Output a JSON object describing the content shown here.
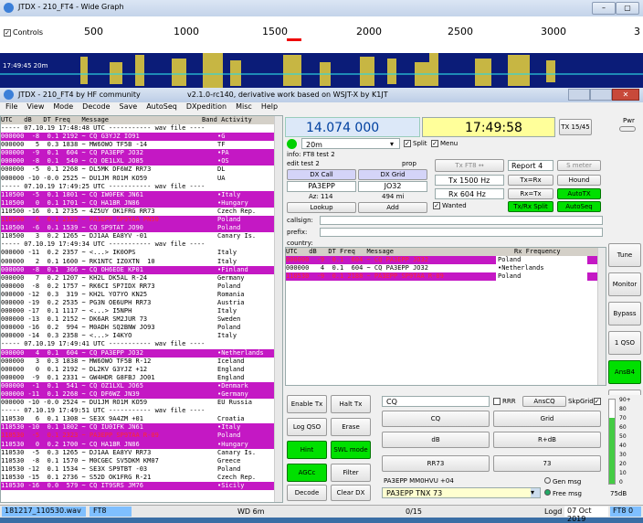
{
  "wide_graph": {
    "title": "JTDX - 210_FT4 - Wide Graph",
    "controls_label": "Controls",
    "scale_ticks": [
      "500",
      "1000",
      "1500",
      "2000",
      "2500",
      "3000",
      "3"
    ],
    "timestamp": "17:49:45  20m"
  },
  "main": {
    "title": "JTDX - 210_FT4  by HF community",
    "subtitle": "v2.1.0-rc140, derivative work based on WSJT-X by K1JT",
    "menu": [
      "File",
      "View",
      "Mode",
      "Decode",
      "Save",
      "AutoSeq",
      "DXpedition",
      "Misc",
      "Help"
    ]
  },
  "band_activity": {
    "header": "UTC   dB   DT Freq   Message",
    "header_right": "Band Activity",
    "rows": [
      {
        "text": "----- 07.10.19 17:48:48 UTC ----------- wav file ----",
        "cty": "",
        "style": "sep"
      },
      {
        "text": "000000  -8  0.1 2192 ~ CQ G3YJZ IO91",
        "cty": "•G",
        "style": "cq"
      },
      {
        "text": "000000   5  0.3 1838 ~ MW6OWO TF5B -14",
        "cty": "TF",
        "style": ""
      },
      {
        "text": "000000  -9  0.1  604 ~ CQ PA3EPP JO32",
        "cty": "•PA",
        "style": "cq"
      },
      {
        "text": "000000  -8  0.1  540 ~ CQ OE1LXL JO85",
        "cty": "•OS",
        "style": "cq"
      },
      {
        "text": "000000  -5  0.1 2268 ~ DL5MK DF6WZ RR73",
        "cty": "DL",
        "style": ""
      },
      {
        "text": "000000 -10 -0.0 2525 ~ DU1JM RO1M KO59",
        "cty": "UA",
        "style": ""
      },
      {
        "text": "----- 07.10.19 17:49:25 UTC ----------- wav file ----",
        "cty": "",
        "style": "sep"
      },
      {
        "text": "110500  -5  0.1 1801 ~ CQ IW0FEK JN61",
        "cty": "•Italy",
        "style": "cq"
      },
      {
        "text": "110500   0  0.1 1701 ~ CQ HA1BR JN86",
        "cty": "•Hungary",
        "style": "cq"
      },
      {
        "text": "110500 -16  0.1 2735 ~ 4Z5UY OK1FRG RR73",
        "cty": "Czech Rep.",
        "style": ""
      },
      {
        "text": "110500  -6  0.1 2322 ~ PA3EPP SP9TAA PN50",
        "cty": "Poland",
        "style": "red"
      },
      {
        "text": "110500  -6  0.1 1539 ~ CQ SP9TAT JO90",
        "cty": "Poland",
        "style": "cq"
      },
      {
        "text": "110500   3  0.2 1265 ~ DJ1AA EA8YV -01",
        "cty": "Canary Is.",
        "style": ""
      },
      {
        "text": "----- 07.10.19 17:49:34 UTC ----------- wav file ----",
        "cty": "",
        "style": "sep"
      },
      {
        "text": "000000 -11  0.2 2357 ~ <...> IK0OPS",
        "cty": "Italy",
        "style": ""
      },
      {
        "text": "000000   2  0.1 1600 ~ RK1NTC IZ0XTN  10",
        "cty": "Italy",
        "style": ""
      },
      {
        "text": "000000  -8  0.1  366 ~ CQ OH6EOE KP01",
        "cty": "•Finland",
        "style": "cq"
      },
      {
        "text": "000000   7  0.2 1207 ~ KH2L DK5AL R-24",
        "cty": "Germany",
        "style": ""
      },
      {
        "text": "000000  -8  0.2 1757 ~ RK6CI SP7IDX RR73",
        "cty": "Poland",
        "style": ""
      },
      {
        "text": "000000 -12  0.3  319 ~ KH2L YO7YO KN25",
        "cty": "Romania",
        "style": ""
      },
      {
        "text": "000000 -19  0.2 2535 ~ PG3N OE6UPH RR73",
        "cty": "Austria",
        "style": ""
      },
      {
        "text": "000000 -17  0.1 1117 ~ <...> I5NPH",
        "cty": "Italy",
        "style": ""
      },
      {
        "text": "000000 -13  0.1 2152 ~ DK6AR SM2JUR 73",
        "cty": "Sweden",
        "style": ""
      },
      {
        "text": "000000 -16  0.2  994 ~ M0ADH SQ2BNW JO93",
        "cty": "Poland",
        "style": ""
      },
      {
        "text": "000000 -14  0.3 2358 ~ <...> I4KYO",
        "cty": "Italy",
        "style": ""
      },
      {
        "text": "----- 07.10.19 17:49:41 UTC ----------- wav file ----",
        "cty": "",
        "style": "sep"
      },
      {
        "text": "000000   4  0.1  604 ~ CQ PA3EPP JO32",
        "cty": "•Netherlands",
        "style": "cq"
      },
      {
        "text": "000000   3  0.3 1838 ~ MW6OWO TF5B R-12",
        "cty": "Iceland",
        "style": ""
      },
      {
        "text": "000000   0  0.1 2192 ~ DL2KV G3YJZ +12",
        "cty": "England",
        "style": ""
      },
      {
        "text": "000000  -9  0.1 2331 ~ GW4HDR G8FBJ JO01",
        "cty": "England",
        "style": ""
      },
      {
        "text": "000000  -1  0.1  541 ~ CQ OZ1LXL JO65",
        "cty": "•Denmark",
        "style": "cq"
      },
      {
        "text": "000000 -11  0.1 2268 ~ CQ DF6WZ JN39",
        "cty": "•Germany",
        "style": "cq"
      },
      {
        "text": "000000 -10 -0.0 2524 ~ DU1JM RO1M KO59",
        "cty": "EU Russia",
        "style": ""
      },
      {
        "text": "----- 07.10.19 17:49:51 UTC ----------- wav file ----",
        "cty": "",
        "style": "sep"
      },
      {
        "text": "110530   6  0.1 1308 ~ SE3X 9A4ZM +01",
        "cty": "Croatia",
        "style": ""
      },
      {
        "text": "110530 -10  0.1 1802 ~ CQ IU0IFK JN61",
        "cty": "•Italy",
        "style": "cq"
      },
      {
        "text": "110530  -5  0.1 2323 ~ PA3EPP SP9TAA R-09",
        "cty": "Poland",
        "style": "red"
      },
      {
        "text": "110530   0  0.2 1700 ~ CQ HA1BR JN86",
        "cty": "•Hungary",
        "style": "cq"
      },
      {
        "text": "110530  -5  0.3 1265 ~ DJ1AA EA8YV RR73",
        "cty": "Canary Is.",
        "style": ""
      },
      {
        "text": "110530  -8  0.1 1570 ~ M0CGEC SV5DKM KM07",
        "cty": "Greece",
        "style": ""
      },
      {
        "text": "110530 -12  0.1 1534 ~ SE3X SP9TBT -03",
        "cty": "Poland",
        "style": ""
      },
      {
        "text": "110530 -15  0.1 2736 ~ S52D OK1FRG R-21",
        "cty": "Czech Rep.",
        "style": ""
      },
      {
        "text": "110530 -16  0.0  579 ~ CQ IT9SRS JM76",
        "cty": "•Sicily",
        "style": "cq"
      }
    ]
  },
  "right": {
    "frequency": "14.074 000",
    "clock": "17:49:58",
    "tx_counter": "TX 15/45",
    "pwr_label": "Pwr",
    "band": "20m",
    "split_label": "Split",
    "menu_label": "Menu",
    "info": "info: FT8  test 2",
    "edit": "edit   test 2",
    "prop": "prop",
    "tx_ft8": "Tx FT8 ↔",
    "report": "Report 4",
    "s_meter": "S meter",
    "dx_call_label": "DX Call",
    "dx_grid_label": "DX Grid",
    "dx_call": "PA3EPP",
    "dx_grid": "JO32",
    "az": "Az: 114",
    "dist": "494 mi",
    "tx_hz": "Tx 1500 Hz",
    "rx_hz": "Rx 604 Hz",
    "tx_rx": "Tx=Rx",
    "hound": "Hound",
    "rx_tx": "Rx=Tx",
    "autotx": "AutoTX",
    "lookup": "Lookup",
    "add": "Add",
    "wanted": "Wanted",
    "tx_rx_split": "Tx/Rx Split",
    "autoseq": "AutoSeq",
    "callsign": "callsign:",
    "prefix": "prefix:",
    "country": "country:",
    "rx_header": "UTC   dB   DT Freq   Message",
    "rx_header_right": "Rx Frequency",
    "rx_rows": [
      {
        "text": "000000  -9  0.1  604 ~ CQ PA3EPP JO32",
        "cty": "Poland"
      },
      {
        "text": "000000   4  0.1  604 ~ CQ PA3EPP JO32",
        "cty": "•Netherlands"
      },
      {
        "text": "110530  -9  0.1 2188 ~ PA3EPP SP9TAA R-09",
        "cty": "Poland"
      }
    ],
    "side_buttons": [
      "Tune",
      "Monitor",
      "Bypass",
      "1 QSO",
      "AnsB4",
      "Stop"
    ],
    "enable_tx": "Enable Tx",
    "halt_tx": "Halt Tx",
    "log_qso": "Log QSO",
    "erase": "Erase",
    "hint": "Hint",
    "swl": "SWL mode",
    "agcc": "AGCc",
    "filter": "Filter",
    "decode": "Decode",
    "clear_dx": "Clear DX",
    "tx_cq": "CQ",
    "rrr": "RRR",
    "ans_cq": "AnsCQ",
    "skip_grid": "SkpGrid",
    "m_cq": "CQ",
    "m_grid": "Grid",
    "m_db": "dB",
    "m_rdb": "R+dB",
    "m_rr73": "RR73",
    "m_73": "73",
    "gen_line": "PA3EPP MM0HVU +04",
    "gen_msg": "Gen msg",
    "free_line": "PA3EPP TNX 73",
    "free_msg": "Free msg",
    "meter_ticks": [
      "90+",
      "80",
      "70",
      "60",
      "50",
      "40",
      "30",
      "20",
      "10",
      "0"
    ],
    "meter_value": "75dB"
  },
  "status_bar": {
    "file": "181217_110530.wav",
    "mode": "FT8",
    "wd": "WD 6m",
    "count": "0/15",
    "logd": "Logd",
    "date": "07 Oct 2019",
    "mode2": "FT8  0"
  }
}
